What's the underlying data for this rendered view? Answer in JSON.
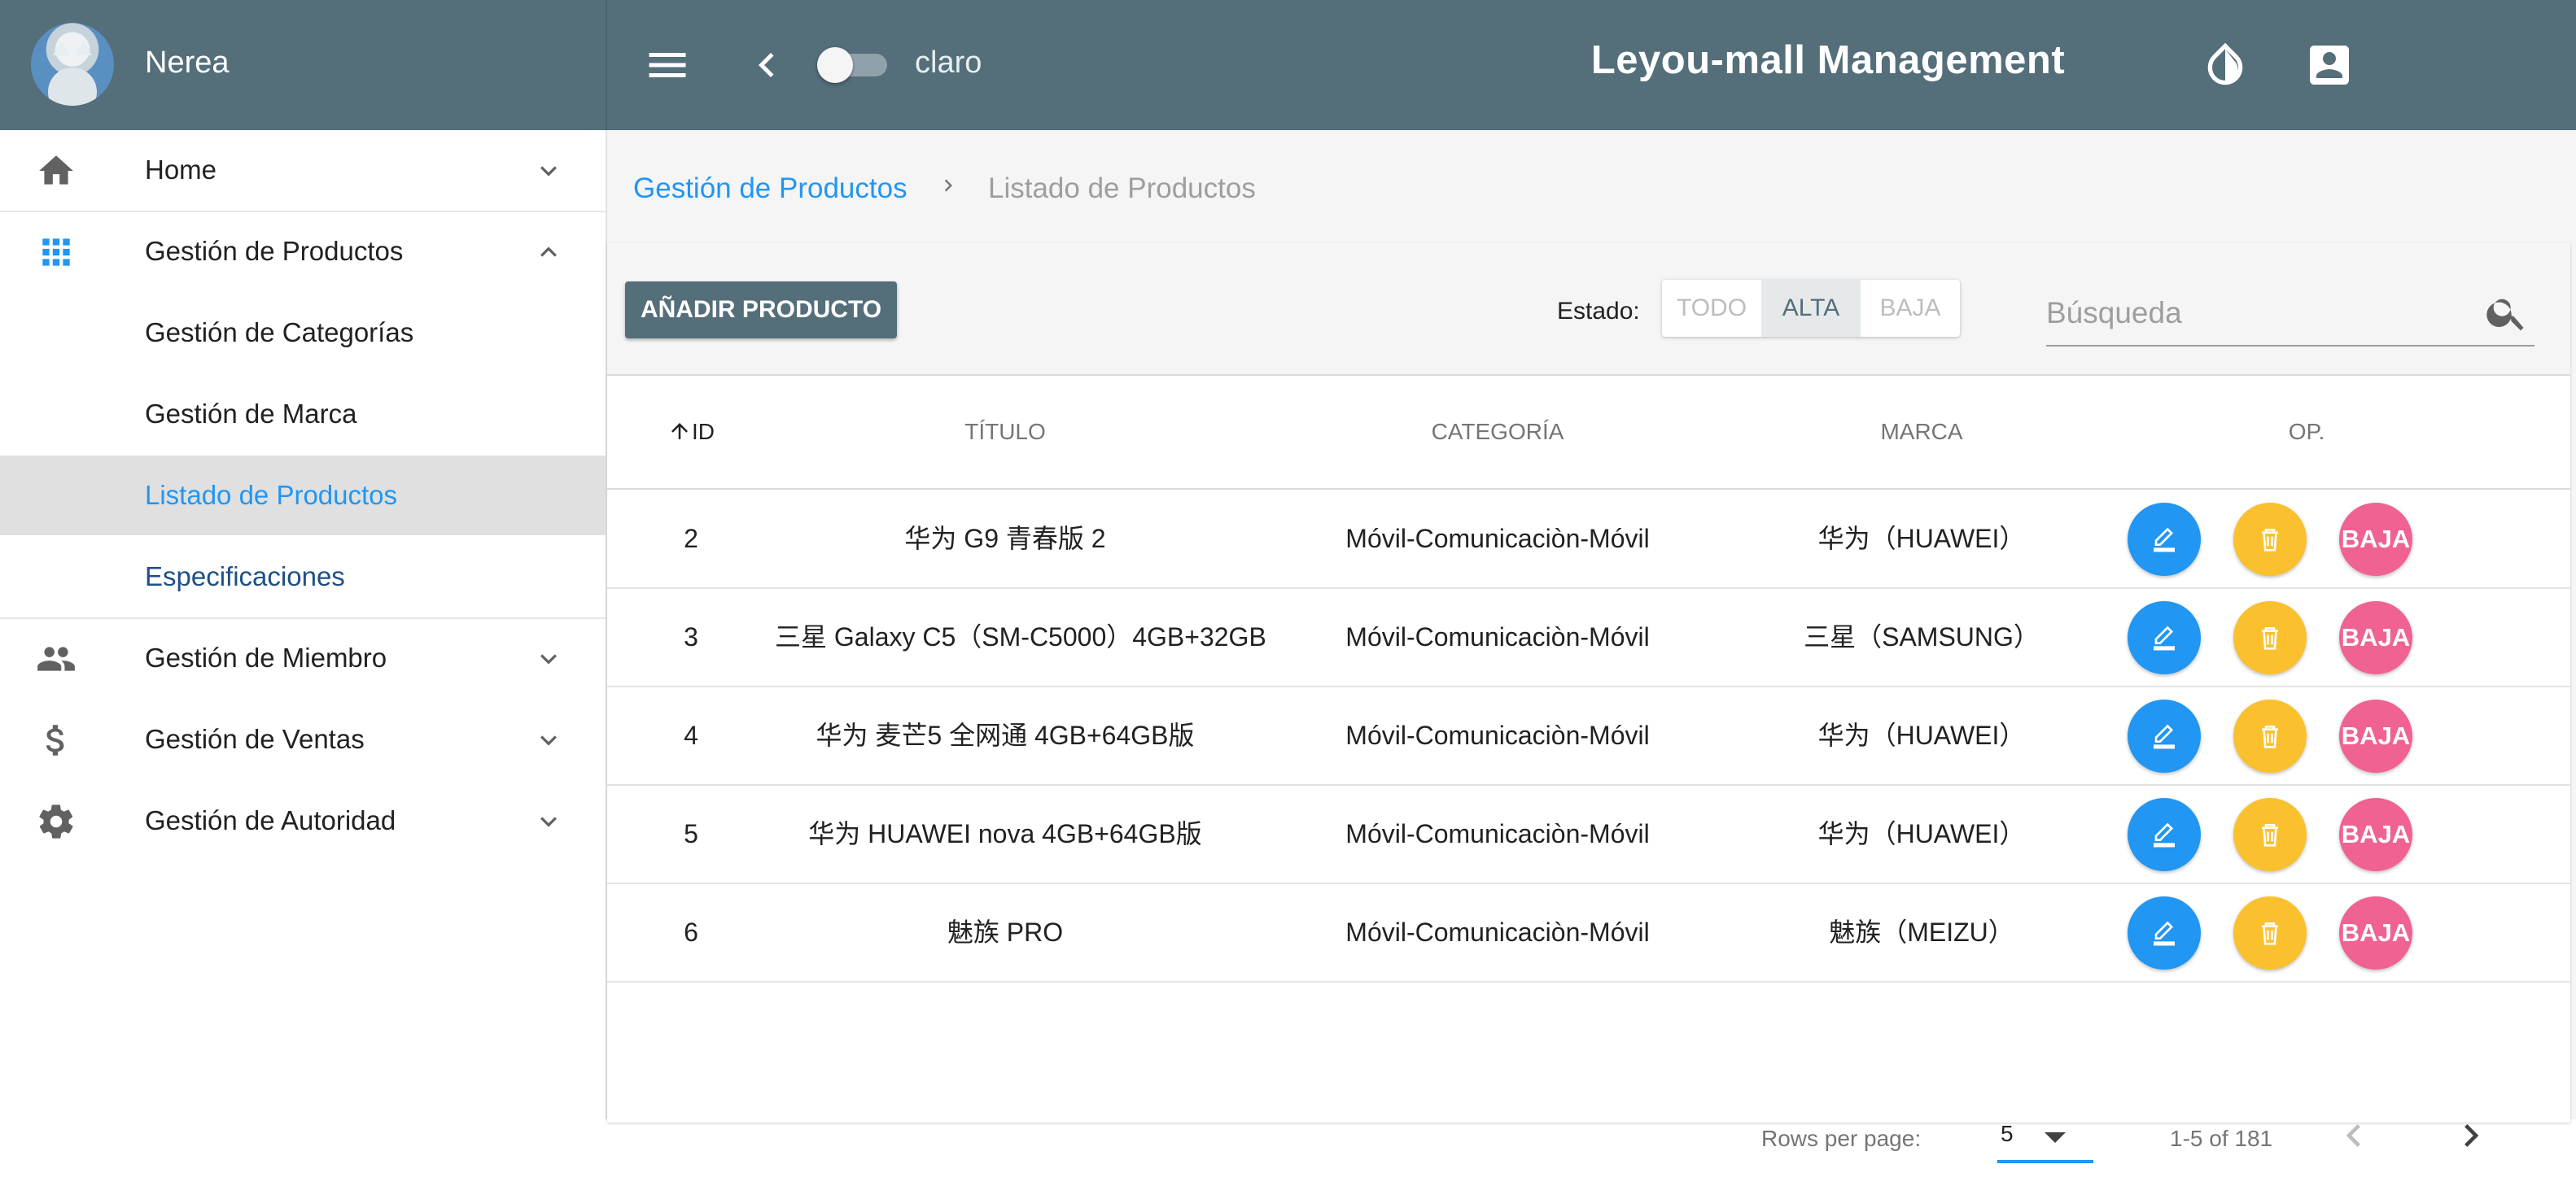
{
  "user": {
    "name": "Nerea"
  },
  "topbar": {
    "theme_label": "claro",
    "title": "Leyou-mall Management"
  },
  "sidebar": {
    "items": [
      {
        "label": "Home",
        "icon": "home-icon",
        "expanded": false
      },
      {
        "label": "Gestión de Productos",
        "icon": "grid-icon",
        "expanded": true,
        "children": [
          {
            "label": "Gestión de Categorías"
          },
          {
            "label": "Gestión de Marca"
          },
          {
            "label": "Listado de Productos",
            "active": true
          },
          {
            "label": "Especificaciones"
          }
        ]
      },
      {
        "label": "Gestión de Miembro",
        "icon": "people-icon",
        "expanded": false
      },
      {
        "label": "Gestión de Ventas",
        "icon": "dollar-icon",
        "expanded": false
      },
      {
        "label": "Gestión de Autoridad",
        "icon": "gear-icon",
        "expanded": false
      }
    ]
  },
  "breadcrumb": {
    "parent": "Gestión de Productos",
    "separator": ">",
    "current": "Listado de Productos"
  },
  "toolbar": {
    "add_label": "AÑADIR PRODUCTO",
    "estado_label": "Estado:",
    "estado_options": [
      "TODO",
      "ALTA",
      "BAJA"
    ],
    "estado_selected": "ALTA",
    "search_placeholder": "Búsqueda"
  },
  "table": {
    "headers": {
      "id": "ID",
      "title": "TÍTULO",
      "category": "CATEGORÍA",
      "brand": "MARCA",
      "op": "OP."
    },
    "sort": {
      "column": "ID",
      "direction": "asc"
    },
    "rows": [
      {
        "id": "2",
        "title": "华为 G9 青春版 2",
        "category": "Móvil-Comunicaciòn-Móvil",
        "brand": "华为（HUAWEI）",
        "baja_label": "BAJA"
      },
      {
        "id": "3",
        "title": "三星 Galaxy C5（SM-C5000）4GB+32GB",
        "category": "Móvil-Comunicaciòn-Móvil",
        "brand": "三星（SAMSUNG）",
        "baja_label": "BAJA"
      },
      {
        "id": "4",
        "title": "华为 麦芒5 全网通 4GB+64GB版",
        "category": "Móvil-Comunicaciòn-Móvil",
        "brand": "华为（HUAWEI）",
        "baja_label": "BAJA"
      },
      {
        "id": "5",
        "title": "华为 HUAWEI nova 4GB+64GB版",
        "category": "Móvil-Comunicaciòn-Móvil",
        "brand": "华为（HUAWEI）",
        "baja_label": "BAJA"
      },
      {
        "id": "6",
        "title": "魅族 PRO",
        "category": "Móvil-Comunicaciòn-Móvil",
        "brand": "魅族（MEIZU）",
        "baja_label": "BAJA"
      }
    ]
  },
  "pagination": {
    "rows_per_page_label": "Rows per page:",
    "rows_per_page": "5",
    "range": "1-5 of 181"
  },
  "colors": {
    "primary": "#546e7a",
    "accent": "#2196f3",
    "edit": "#2196f3",
    "delete": "#fbc02d",
    "baja": "#f06292"
  }
}
